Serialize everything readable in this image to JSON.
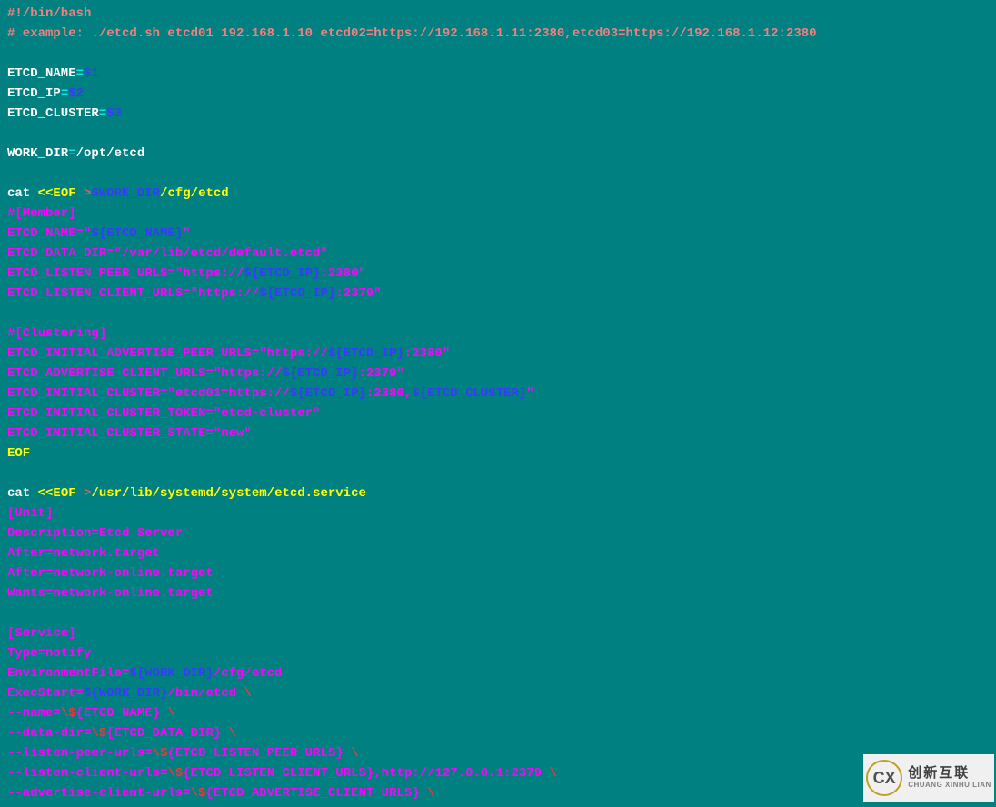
{
  "lines": [
    [
      [
        "salmon",
        "#!/bin/bash"
      ]
    ],
    [
      [
        "salmon",
        "# example: ./etcd.sh etcd01 192.168.1.10 etcd02=https://192.168.1.11:2380,etcd03=https://192.168.1.12:2380"
      ]
    ],
    [],
    [
      [
        "white",
        "ETCD_NAME"
      ],
      [
        "cyan",
        "="
      ],
      [
        "blue",
        "$1"
      ]
    ],
    [
      [
        "white",
        "ETCD_IP"
      ],
      [
        "cyan",
        "="
      ],
      [
        "blue",
        "$2"
      ]
    ],
    [
      [
        "white",
        "ETCD_CLUSTER"
      ],
      [
        "cyan",
        "="
      ],
      [
        "blue",
        "$3"
      ]
    ],
    [],
    [
      [
        "white",
        "WORK_DIR"
      ],
      [
        "cyan",
        "="
      ],
      [
        "white",
        "/opt/etcd"
      ]
    ],
    [],
    [
      [
        "white",
        "cat "
      ],
      [
        "yellow",
        "<<EOF "
      ],
      [
        "amp",
        ">"
      ],
      [
        "blue",
        "$WORK_DIR"
      ],
      [
        "yellow",
        "/cfg/etcd"
      ]
    ],
    [
      [
        "magenta",
        "#[Member]"
      ]
    ],
    [
      [
        "magenta",
        "ETCD_NAME=\""
      ],
      [
        "blue",
        "${ETCD_NAME}"
      ],
      [
        "magenta",
        "\""
      ]
    ],
    [
      [
        "magenta",
        "ETCD_DATA_DIR=\"/var/lib/etcd/default.etcd\""
      ]
    ],
    [
      [
        "magenta",
        "ETCD_LISTEN_PEER_URLS=\"https://"
      ],
      [
        "blue",
        "${ETCD_IP}"
      ],
      [
        "magenta",
        ":2380\""
      ]
    ],
    [
      [
        "magenta",
        "ETCD_LISTEN_CLIENT_URLS=\"https://"
      ],
      [
        "blue",
        "${ETCD_IP}"
      ],
      [
        "magenta",
        ":2379\""
      ]
    ],
    [],
    [
      [
        "magenta",
        "#[Clustering]"
      ]
    ],
    [
      [
        "magenta",
        "ETCD_INITIAL_ADVERTISE_PEER_URLS=\"https://"
      ],
      [
        "blue",
        "${ETCD_IP}"
      ],
      [
        "magenta",
        ":2380\""
      ]
    ],
    [
      [
        "magenta",
        "ETCD_ADVERTISE_CLIENT_URLS=\"https://"
      ],
      [
        "blue",
        "${ETCD_IP}"
      ],
      [
        "magenta",
        ":2379\""
      ]
    ],
    [
      [
        "magenta",
        "ETCD_INITIAL_CLUSTER=\"etcd01=https://"
      ],
      [
        "blue",
        "${ETCD_IP}"
      ],
      [
        "magenta",
        ":2380,"
      ],
      [
        "blue",
        "${ETCD_CLUSTER}"
      ],
      [
        "magenta",
        "\""
      ]
    ],
    [
      [
        "magenta",
        "ETCD_INITIAL_CLUSTER_TOKEN=\"etcd-cluster\""
      ]
    ],
    [
      [
        "magenta",
        "ETCD_INITIAL_CLUSTER_STATE=\"new\""
      ]
    ],
    [
      [
        "yellow",
        "EOF"
      ]
    ],
    [],
    [
      [
        "white",
        "cat "
      ],
      [
        "yellow",
        "<<EOF "
      ],
      [
        "amp",
        ">"
      ],
      [
        "yellow",
        "/usr/lib/systemd/system/etcd.service"
      ]
    ],
    [
      [
        "magenta",
        "[Unit]"
      ]
    ],
    [
      [
        "magenta",
        "Description=Etcd Server"
      ]
    ],
    [
      [
        "magenta",
        "After=network.target"
      ]
    ],
    [
      [
        "magenta",
        "After=network-online.target"
      ]
    ],
    [
      [
        "magenta",
        "Wants=network-online.target"
      ]
    ],
    [],
    [
      [
        "magenta",
        "[Service]"
      ]
    ],
    [
      [
        "magenta",
        "Type=notify"
      ]
    ],
    [
      [
        "magenta",
        "EnvironmentFile="
      ],
      [
        "blue",
        "${WORK_DIR}"
      ],
      [
        "magenta",
        "/cfg/etcd"
      ]
    ],
    [
      [
        "magenta",
        "ExecStart="
      ],
      [
        "blue",
        "${WORK_DIR}"
      ],
      [
        "magenta",
        "/bin/etcd "
      ],
      [
        "red",
        "\\"
      ]
    ],
    [
      [
        "magenta",
        "--name="
      ],
      [
        "red",
        "\\$"
      ],
      [
        "magenta",
        "{ETCD_NAME} "
      ],
      [
        "red",
        "\\"
      ]
    ],
    [
      [
        "magenta",
        "--data-dir="
      ],
      [
        "red",
        "\\$"
      ],
      [
        "magenta",
        "{ETCD_DATA_DIR} "
      ],
      [
        "red",
        "\\"
      ]
    ],
    [
      [
        "magenta",
        "--listen-peer-urls="
      ],
      [
        "red",
        "\\$"
      ],
      [
        "magenta",
        "{ETCD_LISTEN_PEER_URLS} "
      ],
      [
        "red",
        "\\"
      ]
    ],
    [
      [
        "magenta",
        "--listen-client-urls="
      ],
      [
        "red",
        "\\$"
      ],
      [
        "magenta",
        "{ETCD_LISTEN_CLIENT_URLS},http://127.0.0.1:2379 "
      ],
      [
        "red",
        "\\"
      ]
    ],
    [
      [
        "magenta",
        "--advertise-client-urls="
      ],
      [
        "red",
        "\\$"
      ],
      [
        "magenta",
        "{ETCD_ADVERTISE_CLIENT_URLS} "
      ],
      [
        "red",
        "\\"
      ]
    ]
  ],
  "watermark": {
    "logoText": "CX",
    "main": "创新互联",
    "sub": "CHUANG XINHU LIAN"
  }
}
